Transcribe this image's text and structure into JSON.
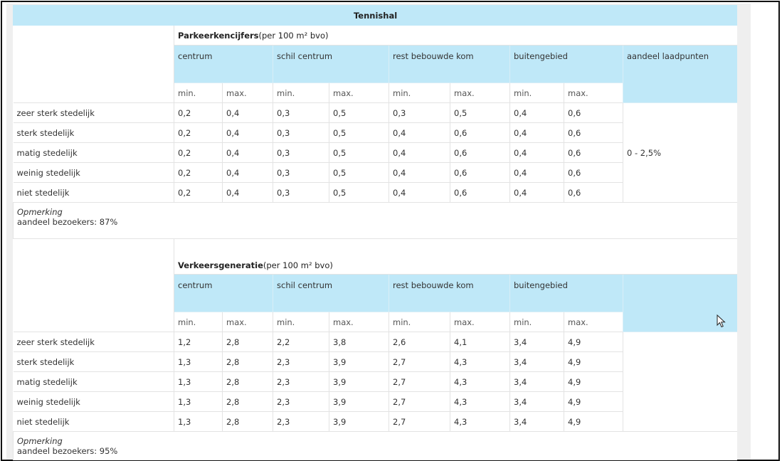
{
  "table_title": "Tennishal",
  "sections": [
    {
      "title_bold": "Parkeerkencijfers",
      "title_rest": "(per 100 m² bvo)",
      "zones": [
        "centrum",
        "schil centrum",
        "rest bebouwde kom",
        "buitengebied"
      ],
      "extra_header": "aandeel laadpunten",
      "minmax": [
        "min.",
        "max."
      ],
      "rows": [
        {
          "label": "zeer sterk stedelijk",
          "values": [
            "0,2",
            "0,4",
            "0,3",
            "0,5",
            "0,3",
            "0,5",
            "0,4",
            "0,6"
          ]
        },
        {
          "label": "sterk stedelijk",
          "values": [
            "0,2",
            "0,4",
            "0,3",
            "0,5",
            "0,4",
            "0,6",
            "0,4",
            "0,6"
          ]
        },
        {
          "label": "matig stedelijk",
          "values": [
            "0,2",
            "0,4",
            "0,3",
            "0,5",
            "0,4",
            "0,6",
            "0,4",
            "0,6"
          ]
        },
        {
          "label": "weinig stedelijk",
          "values": [
            "0,2",
            "0,4",
            "0,3",
            "0,5",
            "0,4",
            "0,6",
            "0,4",
            "0,6"
          ]
        },
        {
          "label": "niet stedelijk",
          "values": [
            "0,2",
            "0,4",
            "0,3",
            "0,5",
            "0,4",
            "0,6",
            "0,4",
            "0,6"
          ]
        }
      ],
      "extra_value": "0 - 2,5%",
      "note_label": "Opmerking",
      "note_text": "aandeel bezoekers: 87%"
    },
    {
      "title_bold": "Verkeersgeneratie",
      "title_rest": "(per 100 m² bvo)",
      "zones": [
        "centrum",
        "schil centrum",
        "rest bebouwde kom",
        "buitengebied"
      ],
      "extra_header": "",
      "minmax": [
        "min.",
        "max."
      ],
      "rows": [
        {
          "label": "zeer sterk stedelijk",
          "values": [
            "1,2",
            "2,8",
            "2,2",
            "3,8",
            "2,6",
            "4,1",
            "3,4",
            "4,9"
          ]
        },
        {
          "label": "sterk stedelijk",
          "values": [
            "1,3",
            "2,8",
            "2,3",
            "3,9",
            "2,7",
            "4,3",
            "3,4",
            "4,9"
          ]
        },
        {
          "label": "matig stedelijk",
          "values": [
            "1,3",
            "2,8",
            "2,3",
            "3,9",
            "2,7",
            "4,3",
            "3,4",
            "4,9"
          ]
        },
        {
          "label": "weinig stedelijk",
          "values": [
            "1,3",
            "2,8",
            "2,3",
            "3,9",
            "2,7",
            "4,3",
            "3,4",
            "4,9"
          ]
        },
        {
          "label": "niet stedelijk",
          "values": [
            "1,3",
            "2,8",
            "2,3",
            "3,9",
            "2,7",
            "4,3",
            "3,4",
            "4,9"
          ]
        }
      ],
      "note_label": "Opmerking",
      "note_text": "aandeel bezoekers: 95%"
    }
  ],
  "colors": {
    "header_bg": "#bfe8f8",
    "frame": "#111111",
    "page_bg": "#efefef"
  },
  "icons": {
    "cursor": "mouse-pointer-icon"
  }
}
